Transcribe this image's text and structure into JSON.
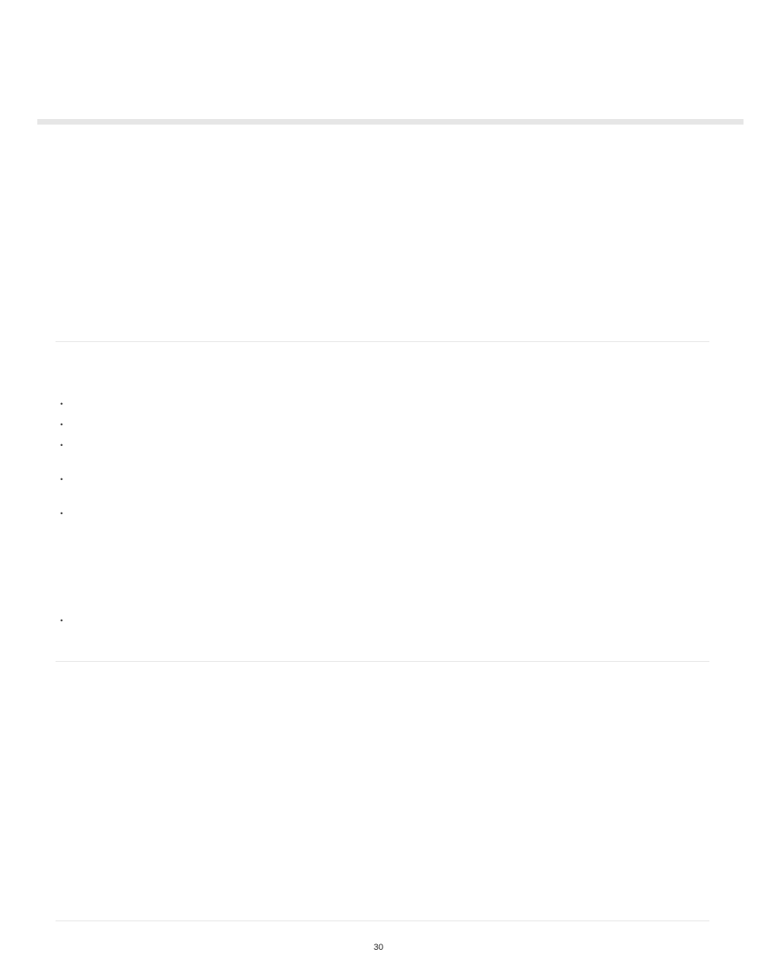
{
  "page_number": "30",
  "bullets": {
    "b1": "•",
    "b2": "•",
    "b3": "•",
    "b4": "•",
    "b5": "•",
    "b6": "•"
  }
}
